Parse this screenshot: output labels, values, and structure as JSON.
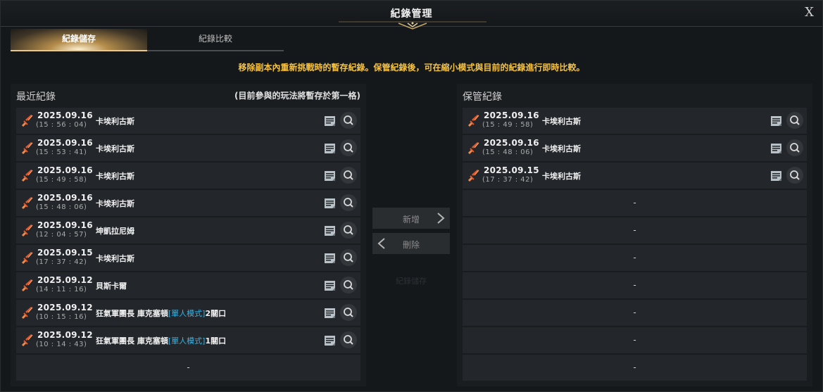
{
  "window": {
    "title": "紀錄管理",
    "close_glyph": "X"
  },
  "tabs": [
    {
      "label": "紀錄儲存",
      "active": true
    },
    {
      "label": "紀錄比較",
      "active": false
    }
  ],
  "notice": "移除副本內重新挑戰時的暫存紀錄。保管紀錄後，可在縮小模式與目前的紀錄進行即時比較。",
  "recent": {
    "title": "最近紀錄",
    "subtitle": "(目前參與的玩法將暫存於第一格)",
    "rows": [
      {
        "date": "2025.09.16",
        "time": "(15 : 56 : 04)",
        "name": "卡埃利古斯",
        "mode": "",
        "suffix": ""
      },
      {
        "date": "2025.09.16",
        "time": "(15 : 53 : 41)",
        "name": "卡埃利古斯",
        "mode": "",
        "suffix": ""
      },
      {
        "date": "2025.09.16",
        "time": "(15 : 49 : 58)",
        "name": "卡埃利古斯",
        "mode": "",
        "suffix": ""
      },
      {
        "date": "2025.09.16",
        "time": "(15 : 48 : 06)",
        "name": "卡埃利古斯",
        "mode": "",
        "suffix": ""
      },
      {
        "date": "2025.09.16",
        "time": "(12 : 04 : 57)",
        "name": "坤凱拉尼姆",
        "mode": "",
        "suffix": ""
      },
      {
        "date": "2025.09.15",
        "time": "(17 : 37 : 42)",
        "name": "卡埃利古斯",
        "mode": "",
        "suffix": ""
      },
      {
        "date": "2025.09.12",
        "time": "(14 : 11 : 16)",
        "name": "貝斯卡爾",
        "mode": "",
        "suffix": ""
      },
      {
        "date": "2025.09.12",
        "time": "(10 : 15 : 16)",
        "name": "狂氣軍團長 庫克塞頓",
        "mode": "[單人模式]",
        "suffix": "2關口"
      },
      {
        "date": "2025.09.12",
        "time": "(10 : 14 : 43)",
        "name": "狂氣軍團長 庫克塞頓",
        "mode": "[單人模式]",
        "suffix": "1關口"
      }
    ],
    "empty_rows": [
      "-"
    ]
  },
  "saved": {
    "title": "保管紀錄",
    "rows": [
      {
        "date": "2025.09.16",
        "time": "(15 : 49 : 58)",
        "name": "卡埃利古斯"
      },
      {
        "date": "2025.09.16",
        "time": "(15 : 48 : 06)",
        "name": "卡埃利古斯"
      },
      {
        "date": "2025.09.15",
        "time": "(17 : 37 : 42)",
        "name": "卡埃利古斯"
      }
    ],
    "empty_rows": [
      "-",
      "-",
      "-",
      "-",
      "-",
      "-",
      "-"
    ]
  },
  "actions": {
    "add_label": "新增",
    "delete_label": "刪除",
    "faint_label": "紀錄儲存"
  },
  "icons": {
    "record": "sword-icon",
    "note": "note-icon",
    "inspect": "search-icon",
    "add_arrow": "chevron-right-icon",
    "delete_arrow": "chevron-left-icon"
  },
  "colors": {
    "notice": "#f5c242",
    "mode": "#36b3e6",
    "sword": "#e0582b",
    "tab_accent": "#e5c98e"
  }
}
